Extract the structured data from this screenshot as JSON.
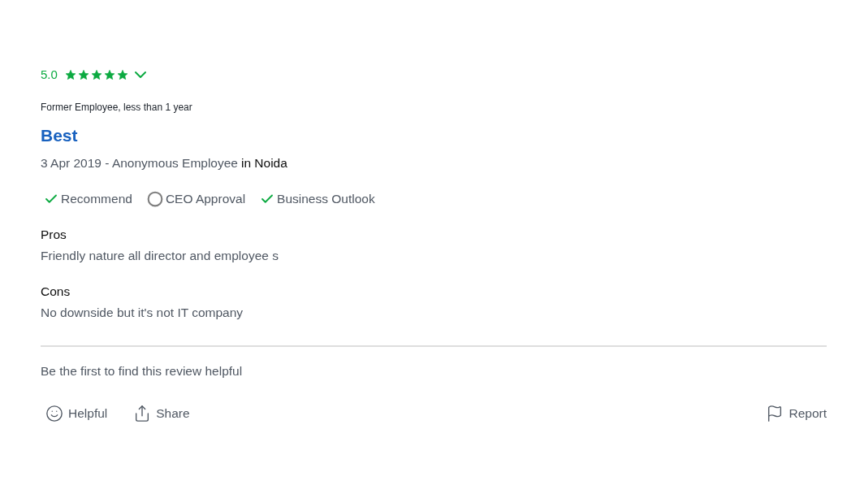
{
  "review": {
    "rating": "5.0",
    "stars": 5,
    "expanded": false,
    "employment": "Former Employee, less than 1 year",
    "title": "Best",
    "date_author": "3 Apr 2019 - Anonymous Employee",
    "location": "in Noida",
    "indicators": [
      {
        "label": "Recommend",
        "kind": "check"
      },
      {
        "label": "CEO Approval",
        "kind": "circle"
      },
      {
        "label": "Business Outlook",
        "kind": "check"
      }
    ],
    "sections": [
      {
        "heading": "Pros",
        "text": "Friendly nature all director and employee s"
      },
      {
        "heading": "Cons",
        "text": "No downside but it's not IT company"
      }
    ]
  },
  "helpful_note": "Be the first to find this review helpful",
  "actions": [
    {
      "kind": "helpful",
      "label": "Helpful"
    },
    {
      "kind": "share",
      "label": "Share"
    },
    {
      "kind": "report",
      "label": "Report"
    }
  ]
}
